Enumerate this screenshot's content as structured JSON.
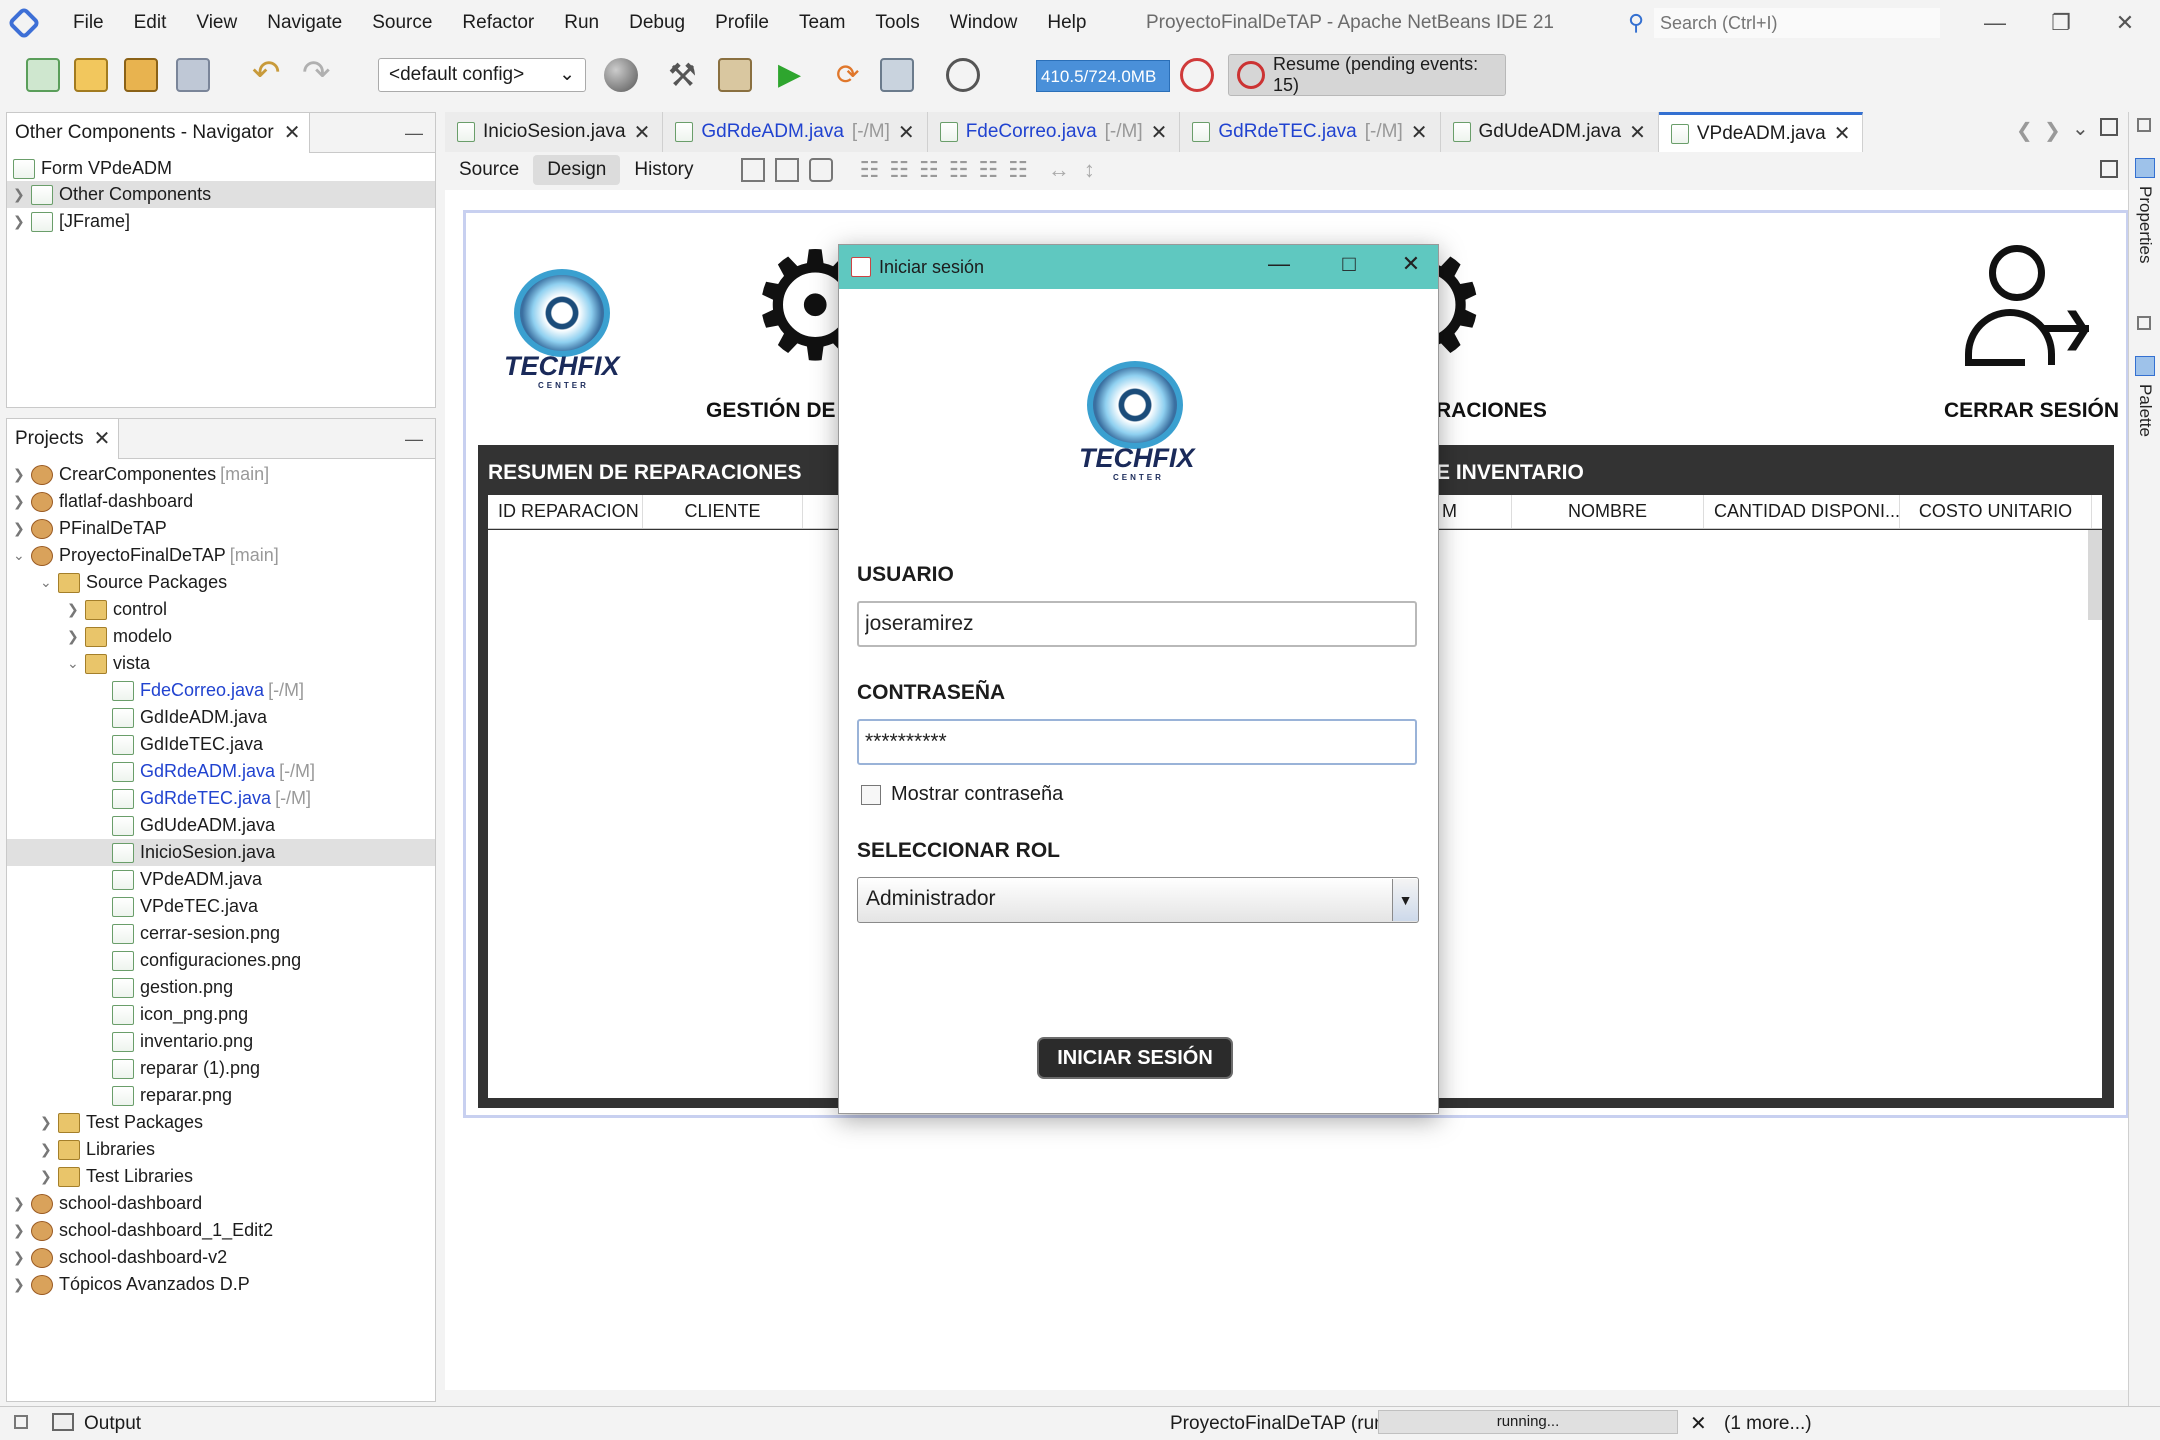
{
  "menu": [
    "File",
    "Edit",
    "View",
    "Navigate",
    "Source",
    "Refactor",
    "Run",
    "Debug",
    "Profile",
    "Team",
    "Tools",
    "Window",
    "Help"
  ],
  "window_title": "ProyectoFinalDeTAP - Apache NetBeans IDE 21",
  "search_placeholder": "Search (Ctrl+I)",
  "toolbar": {
    "config": "<default config>",
    "memory": "410.5/724.0MB",
    "resume": "Resume (pending events: 15)"
  },
  "navigator": {
    "tab": "Other Components - Navigator",
    "items": [
      "Form VPdeADM",
      "Other Components",
      "[JFrame]"
    ]
  },
  "projects": {
    "tab": "Projects",
    "items": [
      {
        "label": "CrearComponentes",
        "suffix": "[main]"
      },
      {
        "label": "flatlaf-dashboard",
        "suffix": ""
      },
      {
        "label": "PFinalDeTAP",
        "suffix": ""
      },
      {
        "label": "ProyectoFinalDeTAP",
        "suffix": "[main]"
      },
      {
        "label": "Source Packages",
        "suffix": ""
      },
      {
        "label": "control",
        "suffix": ""
      },
      {
        "label": "modelo",
        "suffix": ""
      },
      {
        "label": "vista",
        "suffix": ""
      },
      {
        "label": "FdeCorreo.java",
        "suffix": "[-/M]"
      },
      {
        "label": "GdIdeADM.java",
        "suffix": ""
      },
      {
        "label": "GdIdeTEC.java",
        "suffix": ""
      },
      {
        "label": "GdRdeADM.java",
        "suffix": "[-/M]"
      },
      {
        "label": "GdRdeTEC.java",
        "suffix": "[-/M]"
      },
      {
        "label": "GdUdeADM.java",
        "suffix": ""
      },
      {
        "label": "InicioSesion.java",
        "suffix": ""
      },
      {
        "label": "VPdeADM.java",
        "suffix": ""
      },
      {
        "label": "VPdeTEC.java",
        "suffix": ""
      },
      {
        "label": "cerrar-sesion.png",
        "suffix": ""
      },
      {
        "label": "configuraciones.png",
        "suffix": ""
      },
      {
        "label": "gestion.png",
        "suffix": ""
      },
      {
        "label": "icon_png.png",
        "suffix": ""
      },
      {
        "label": "inventario.png",
        "suffix": ""
      },
      {
        "label": "reparar (1).png",
        "suffix": ""
      },
      {
        "label": "reparar.png",
        "suffix": ""
      },
      {
        "label": "Test Packages",
        "suffix": ""
      },
      {
        "label": "Libraries",
        "suffix": ""
      },
      {
        "label": "Test Libraries",
        "suffix": ""
      },
      {
        "label": "school-dashboard",
        "suffix": ""
      },
      {
        "label": "school-dashboard_1_Edit2",
        "suffix": ""
      },
      {
        "label": "school-dashboard-v2",
        "suffix": ""
      },
      {
        "label": "Tópicos Avanzados D.P",
        "suffix": ""
      }
    ]
  },
  "editor_tabs": [
    {
      "label": "InicioSesion.java",
      "suffix": ""
    },
    {
      "label": "GdRdeADM.java",
      "suffix": "[-/M]"
    },
    {
      "label": "FdeCorreo.java",
      "suffix": "[-/M]"
    },
    {
      "label": "GdRdeTEC.java",
      "suffix": "[-/M]"
    },
    {
      "label": "GdUdeADM.java",
      "suffix": ""
    },
    {
      "label": "VPdeADM.java",
      "suffix": ""
    }
  ],
  "editor_subtabs": [
    "Source",
    "Design",
    "History"
  ],
  "form": {
    "logo_word": "TECHFIX",
    "logo_sub": "CENTER",
    "gestion": "GESTIÓN DE U",
    "raciones": "RACIONES",
    "cerrar": "CERRAR SESIÓN",
    "resumen": "RESUMEN DE REPARACIONES",
    "inventario": "E INVENTARIO",
    "left_headers": [
      "ID REPARACION",
      "CLIENTE"
    ],
    "right_headers": [
      "M",
      "NOMBRE",
      "CANTIDAD DISPONI...",
      "COSTO UNITARIO"
    ]
  },
  "dialog": {
    "title": "Iniciar sesión",
    "usuario_label": "USUARIO",
    "usuario_value": "joseramirez",
    "password_label": "CONTRASEÑA",
    "password_value": "**********",
    "show_password": "Mostrar contraseña",
    "role_label": "SELECCIONAR ROL",
    "role_value": "Administrador",
    "login_button": "INICIAR SESIÓN"
  },
  "right_strip": [
    "Properties",
    "Palette"
  ],
  "status": {
    "output": "Output",
    "run": "ProyectoFinalDeTAP (run)",
    "progress": "running...",
    "more": "(1 more...)"
  }
}
